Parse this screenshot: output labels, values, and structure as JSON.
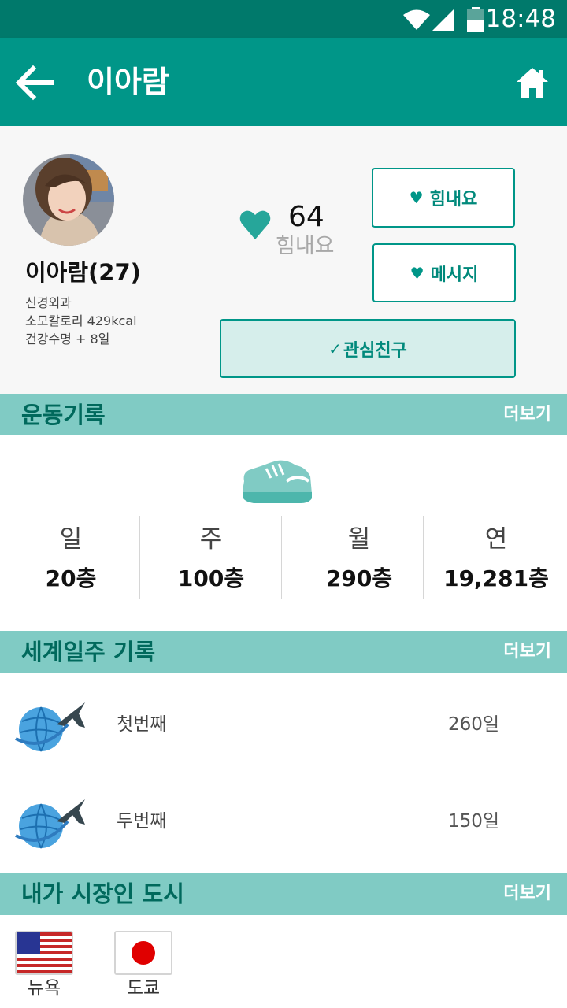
{
  "status_bar": {
    "time": "18:48"
  },
  "app_bar": {
    "title": "이아람"
  },
  "profile": {
    "name": "이아람(27)",
    "details": [
      "신경외과",
      "소모칼로리 429kcal",
      "건강수명 + 8일"
    ],
    "cheer_count": "64",
    "cheer_label": "힘내요",
    "buttons": {
      "cheer": "힘내요",
      "message": "메시지",
      "interest": "관심친구"
    }
  },
  "exercise": {
    "title": "운동기록",
    "more": "더보기",
    "stats": [
      {
        "period": "일",
        "value": "20층"
      },
      {
        "period": "주",
        "value": "100층"
      },
      {
        "period": "월",
        "value": "290층"
      },
      {
        "period": "연",
        "value": "19,281층"
      }
    ]
  },
  "world_tour": {
    "title": "세계일주 기록",
    "more": "더보기",
    "trips": [
      {
        "name": "첫번째",
        "days": "260일"
      },
      {
        "name": "두번째",
        "days": "150일"
      }
    ]
  },
  "mayor_cities": {
    "title": "내가 시장인 도시",
    "more": "더보기",
    "cities": [
      {
        "name": "뉴욕",
        "flag": "us-flag-icon"
      },
      {
        "name": "도쿄",
        "flag": "japan-flag-icon"
      }
    ]
  },
  "colors": {
    "primary": "#009688",
    "dark": "#00796b",
    "section": "#80cbc4",
    "accent_text": "#00695c"
  }
}
